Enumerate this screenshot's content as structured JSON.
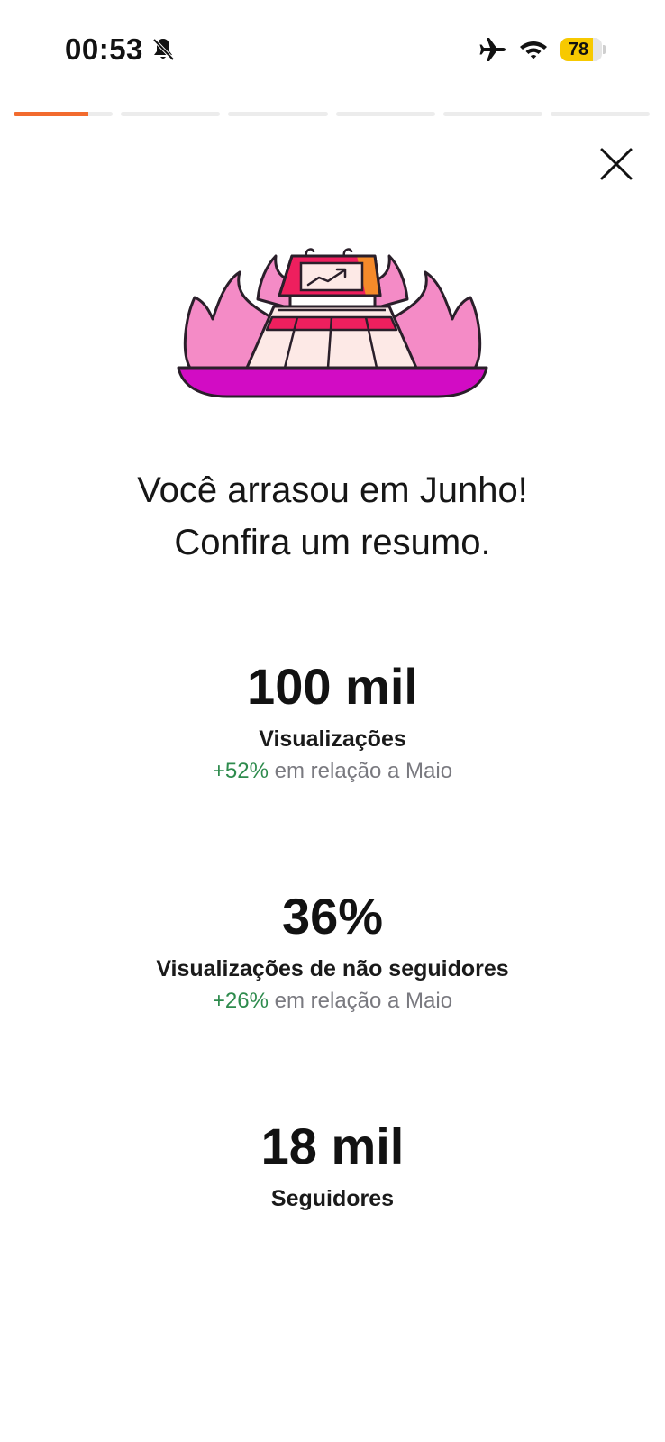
{
  "status_bar": {
    "time": "00:53",
    "battery_level": "78",
    "battery_fraction": 0.78,
    "icons": [
      "bell-slash-icon",
      "airplane-icon",
      "wifi-icon",
      "battery-icon"
    ]
  },
  "story_progress": {
    "segments": 6,
    "active_index": 0,
    "active_fill": 0.75,
    "accent_color": "#f26b2e"
  },
  "close_icon": "close-icon",
  "illustration_icon": "flaming-stage-chart-icon",
  "headline": {
    "line1": "Você arrasou em Junho!",
    "line2": "Confira um resumo."
  },
  "stats": [
    {
      "value": "100 mil",
      "label": "Visualizações",
      "change_pct": "+52%",
      "change_text": "em relação a Maio"
    },
    {
      "value": "36%",
      "label": "Visualizações de não seguidores",
      "change_pct": "+26%",
      "change_text": "em relação a Maio"
    },
    {
      "value": "18 mil",
      "label": "Seguidores"
    }
  ],
  "colors": {
    "positive": "#2e8b4d",
    "muted": "#7a7a80",
    "flame_pink": "#f48bc6",
    "stage_magenta": "#d20cc4",
    "stage_red": "#ee1f5e"
  }
}
